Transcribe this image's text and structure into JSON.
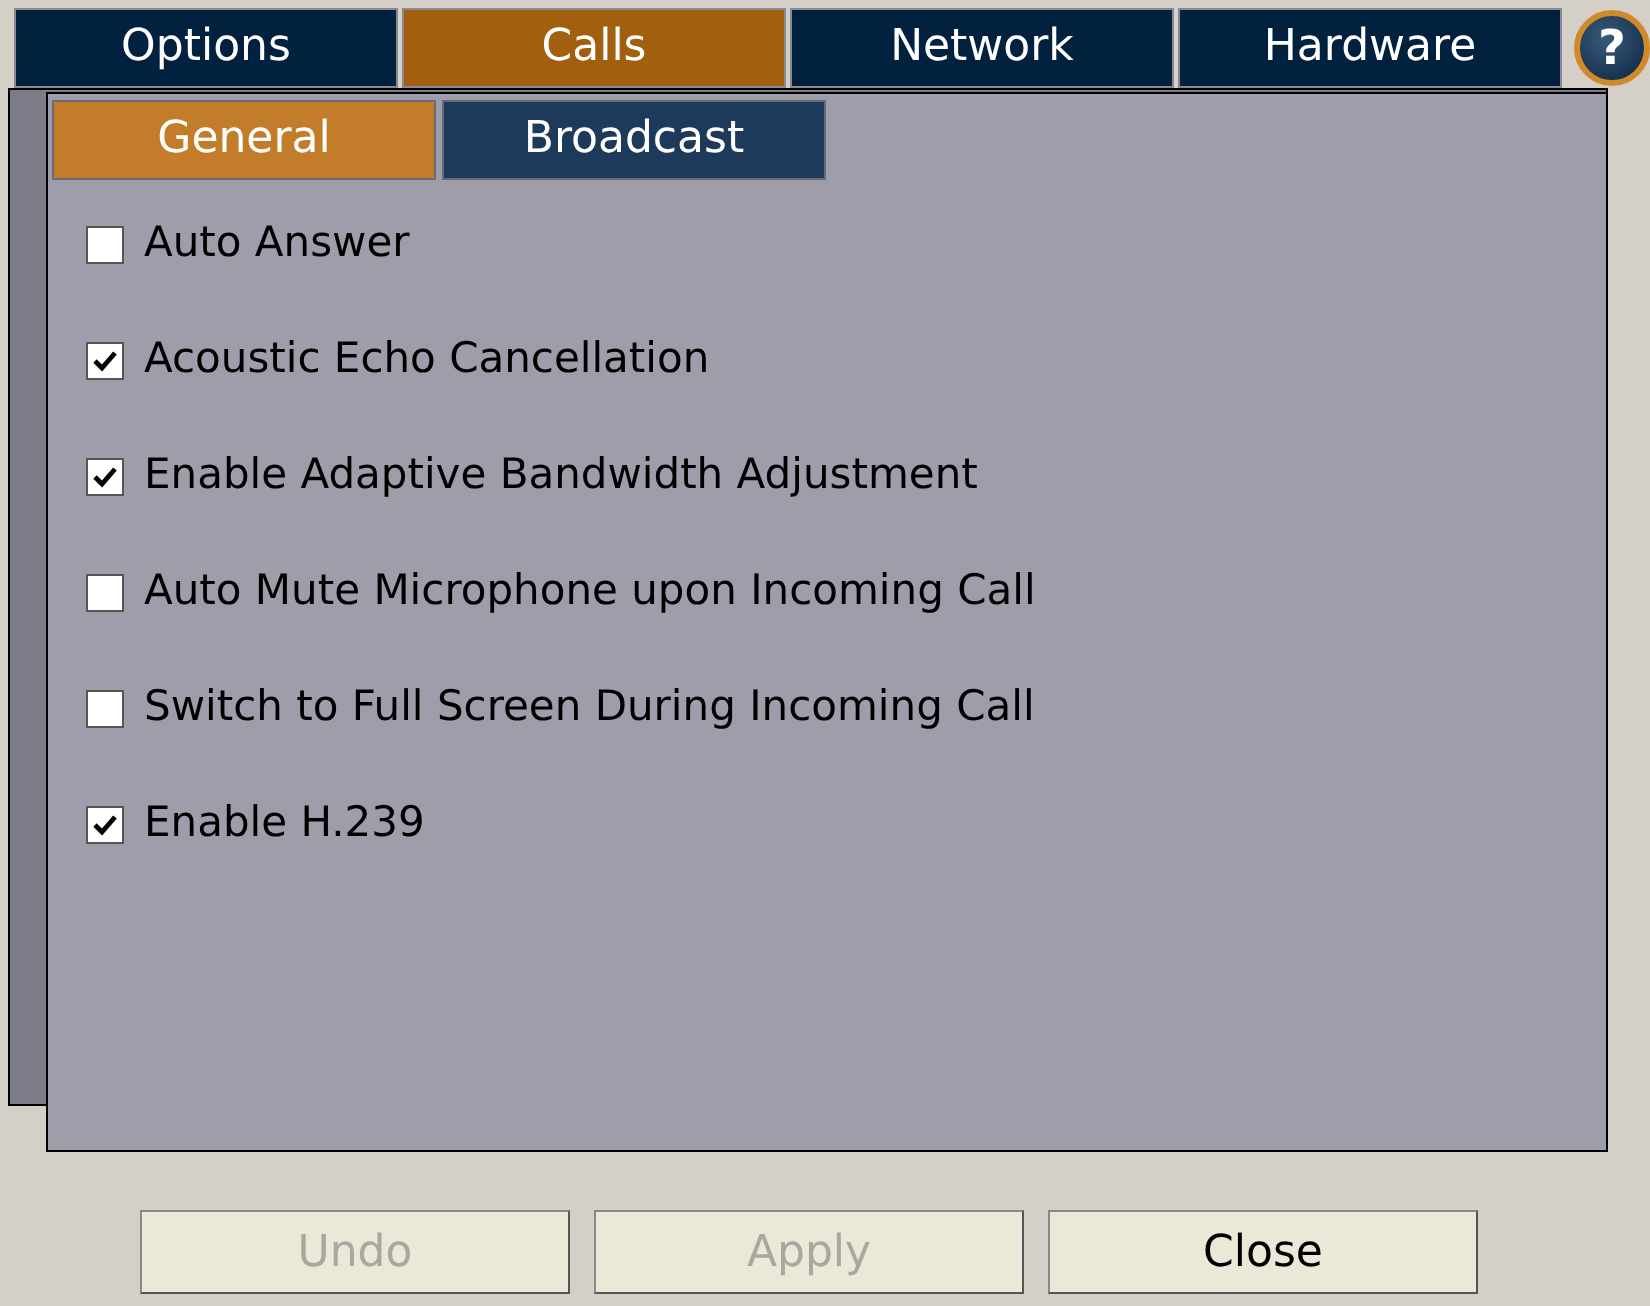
{
  "tabs": [
    {
      "label": "Options",
      "selected": false
    },
    {
      "label": "Calls",
      "selected": true
    },
    {
      "label": "Network",
      "selected": false
    },
    {
      "label": "Hardware",
      "selected": false
    }
  ],
  "help_button": {
    "label": "?"
  },
  "subtabs": [
    {
      "label": "General",
      "selected": true
    },
    {
      "label": "Broadcast",
      "selected": false
    }
  ],
  "options": [
    {
      "label": "Auto Answer",
      "checked": false
    },
    {
      "label": "Acoustic Echo Cancellation",
      "checked": true
    },
    {
      "label": "Enable Adaptive Bandwidth Adjustment",
      "checked": true
    },
    {
      "label": "Auto Mute Microphone upon Incoming Call",
      "checked": false
    },
    {
      "label": "Switch to Full Screen During Incoming Call",
      "checked": false
    },
    {
      "label": "Enable H.239",
      "checked": true
    }
  ],
  "buttons": [
    {
      "label": "Undo",
      "disabled": true
    },
    {
      "label": "Apply",
      "disabled": true
    },
    {
      "label": "Close",
      "disabled": false
    }
  ]
}
